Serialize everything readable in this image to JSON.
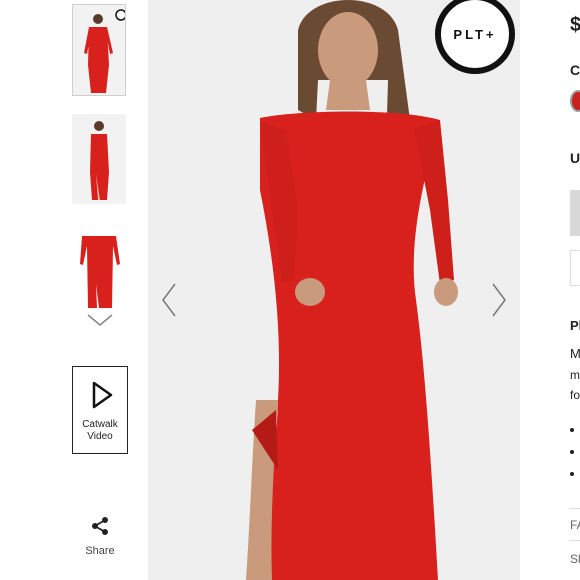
{
  "brand": {
    "badge_text": "PLT+"
  },
  "media": {
    "catwalk_label": "Catwalk\nVideo",
    "share_label": "Share",
    "dress_color": "#d8211c"
  },
  "right_panel": {
    "price": "$",
    "colour_label": "C",
    "size_label": "U",
    "details_heading": "Pl",
    "desc_line1": "M",
    "desc_line2": "m",
    "desc_line3": "fo",
    "section1": "FA",
    "section2": "Sl"
  }
}
